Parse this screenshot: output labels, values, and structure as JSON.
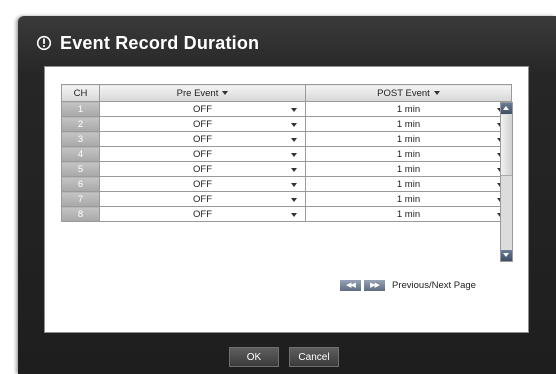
{
  "dialog": {
    "title": "Event Record Duration",
    "title_icon": "info-circle-icon"
  },
  "table": {
    "headers": {
      "ch": "CH",
      "pre": "Pre Event",
      "post": "POST Event"
    },
    "rows": [
      {
        "ch": "1",
        "pre": "OFF",
        "post": "1 min"
      },
      {
        "ch": "2",
        "pre": "OFF",
        "post": "1 min"
      },
      {
        "ch": "3",
        "pre": "OFF",
        "post": "1 min"
      },
      {
        "ch": "4",
        "pre": "OFF",
        "post": "1 min"
      },
      {
        "ch": "5",
        "pre": "OFF",
        "post": "1 min"
      },
      {
        "ch": "6",
        "pre": "OFF",
        "post": "1 min"
      },
      {
        "ch": "7",
        "pre": "OFF",
        "post": "1 min"
      },
      {
        "ch": "8",
        "pre": "OFF",
        "post": "1 min"
      }
    ]
  },
  "pager": {
    "prev_icon": "rewind-icon",
    "next_icon": "fast-forward-icon",
    "label": "Previous/Next Page"
  },
  "buttons": {
    "ok": "OK",
    "cancel": "Cancel"
  },
  "colors": {
    "dialog_bg": "#262626",
    "panel_bg": "#ffffff",
    "ch_cell": "#b0b0b0",
    "accent": "#5f6d82"
  }
}
